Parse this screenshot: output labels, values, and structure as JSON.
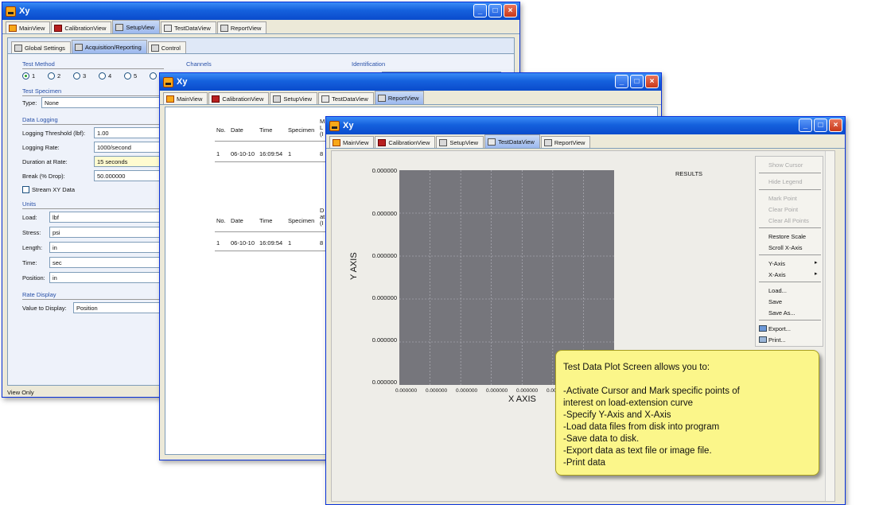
{
  "win1": {
    "title": "Xy",
    "tabs": [
      "MainView",
      "CalibrationView",
      "SetupView",
      "TestDataView",
      "ReportView"
    ],
    "subtabs": [
      "Global Settings",
      "Acquisition/Reporting",
      "Control"
    ],
    "test_method": {
      "label": "Test Method",
      "options": [
        "1",
        "2",
        "3",
        "4",
        "5"
      ]
    },
    "channels_label": "Channels",
    "identification_label": "Identification",
    "test_specimen": {
      "label": "Test Specimen",
      "type_label": "Type:",
      "type_value": "None"
    },
    "data_logging": {
      "label": "Data Logging",
      "threshold_label": "Logging Threshold (lbf):",
      "threshold_value": "1.00",
      "rate_label": "Logging Rate:",
      "rate_value": "1000/second",
      "duration_label": "Duration at Rate:",
      "duration_value": "15 seconds",
      "break_label": "Break (% Drop):",
      "break_value": "50.000000",
      "stream_label": "Stream XY Data"
    },
    "units": {
      "label": "Units",
      "rows": [
        {
          "label": "Load:",
          "value": "lbf"
        },
        {
          "label": "Stress:",
          "value": "psi"
        },
        {
          "label": "Length:",
          "value": "in"
        },
        {
          "label": "Time:",
          "value": "sec"
        },
        {
          "label": "Position:",
          "value": "in"
        }
      ]
    },
    "rate_display": {
      "label": "Rate Display",
      "value_label": "Value to Display:",
      "value": "Position"
    },
    "status": "View Only"
  },
  "win2": {
    "title": "Xy",
    "tabs": [
      "MainView",
      "CalibrationView",
      "SetupView",
      "TestDataView",
      "ReportView"
    ],
    "table1": {
      "headers": [
        "No.",
        "Date",
        "Time",
        "Specimen",
        "M L (I"
      ],
      "row": [
        "1",
        "06-10-10",
        "16:09:54",
        "1",
        "8"
      ]
    },
    "table2": {
      "headers": [
        "No.",
        "Date",
        "Time",
        "Specimen",
        "D at (I"
      ],
      "row": [
        "1",
        "06-10-10",
        "16:09:54",
        "1",
        "8"
      ]
    }
  },
  "win3": {
    "title": "Xy",
    "tabs": [
      "MainView",
      "CalibrationView",
      "SetupView",
      "TestDataView",
      "ReportView"
    ],
    "plot": {
      "y_axis_label": "Y AXIS",
      "x_axis_label": "X AXIS",
      "y_ticks": [
        "0.000000",
        "0.000000",
        "0.000000",
        "0.000000",
        "0.000000",
        "0.000000"
      ],
      "x_ticks": [
        "0.000000",
        "0.000000",
        "0.000000",
        "0.000000",
        "0.000000",
        "0.000000"
      ],
      "results_label": "RESULTS",
      "background_color": "#76767c"
    },
    "menu": {
      "show_cursor": "Show Cursor",
      "hide_legend": "Hide Legend",
      "mark_point": "Mark Point",
      "clear_point": "Clear Point",
      "clear_all_points": "Clear All Points",
      "restore_scale": "Restore Scale",
      "scroll_x_axis": "Scroll X-Axis",
      "y_axis": "Y-Axis",
      "x_axis": "X-Axis",
      "load": "Load...",
      "save": "Save",
      "save_as": "Save As...",
      "export": "Export...",
      "print": "Print..."
    }
  },
  "callout": {
    "lines": [
      "Test Data Plot Screen allows you to:",
      "",
      "-Activate Cursor and Mark specific points of",
      "interest on load-extension curve",
      "-Specify Y-Axis and X-Axis",
      "-Load data files from disk into program",
      "-Save data to disk.",
      "-Export data as text file  or image file.",
      "-Print data"
    ]
  }
}
